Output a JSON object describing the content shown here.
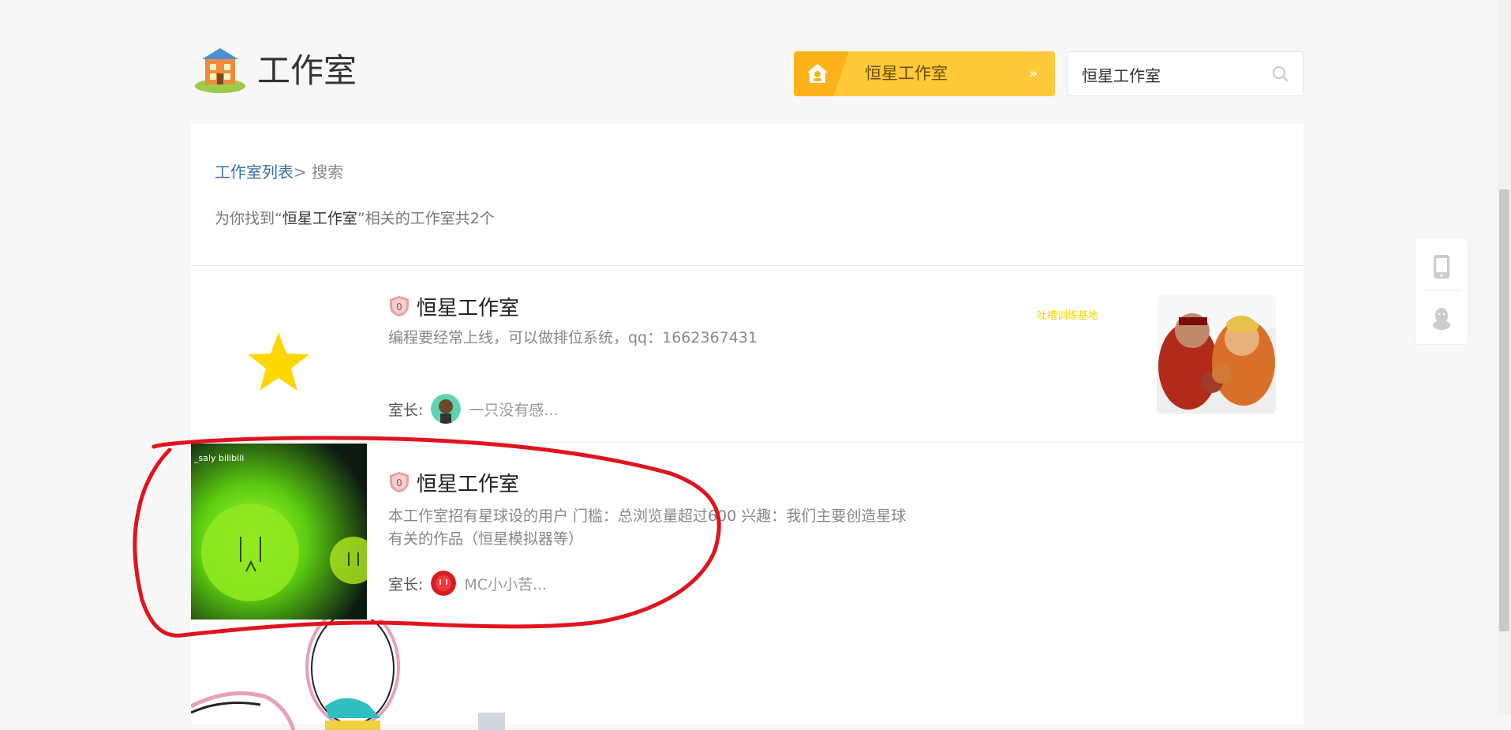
{
  "header": {
    "title": "工作室",
    "current_studio": "恒星工作室",
    "switch_arrows": "»",
    "search": {
      "value": "恒星工作室",
      "placeholder": ""
    }
  },
  "breadcrumb": {
    "root": "工作室列表",
    "sep": "> ",
    "current": "搜索"
  },
  "result_summary": {
    "prefix": "为你找到“",
    "query": "恒星工作室",
    "suffix": "”相关的工作室共2个"
  },
  "results": [
    {
      "badge": "0",
      "name": "恒星工作室",
      "description": "编程要经常上线，可以做排位系统，qq：1662367431",
      "owner_label": "室长:",
      "owner_name": "一只没有感...",
      "tag": "吐槽训练基地"
    },
    {
      "badge": "0",
      "name": "恒星工作室",
      "description_line1": "本工作室招有星球设的用户 门槛：总浏览量超过600 兴趣：我们主要创造星球",
      "description_line2": "有关的作品（恒星模拟器等）",
      "owner_label": "室长:",
      "owner_name": "MC小小苦...",
      "thumb_text": "_saly bilibili"
    }
  ],
  "colors": {
    "accent": "#ffc93a",
    "link": "#3a6ea5",
    "annotation": "#e0141e"
  },
  "icons": [
    "building-icon",
    "home-icon",
    "search-icon",
    "shield-badge-icon",
    "phone-icon",
    "qq-icon",
    "star-icon"
  ]
}
